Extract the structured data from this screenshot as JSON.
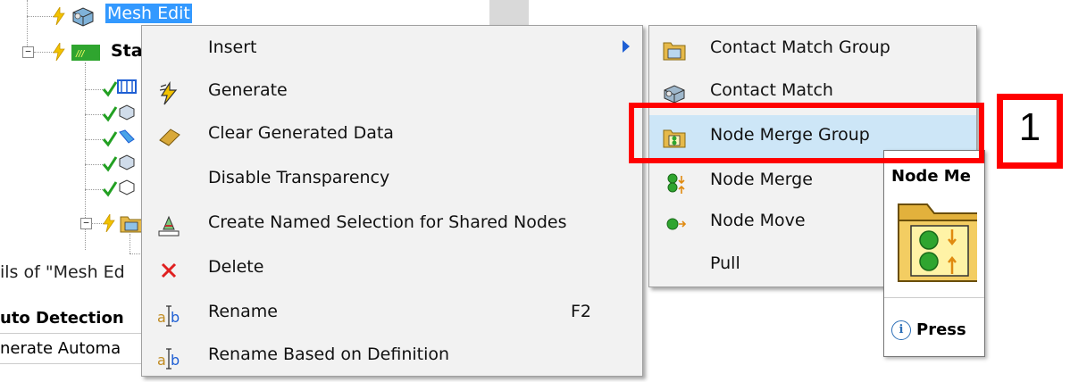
{
  "tree": {
    "mesh_edit_label": "Mesh Edit",
    "static_label": "Stat"
  },
  "details": {
    "title": "ils of \"Mesh Ed",
    "row1": "uto Detection",
    "row2": "nerate Automa"
  },
  "context_menu": {
    "items": [
      {
        "label": "Insert",
        "icon": "none",
        "has_submenu": true
      },
      {
        "label": "Generate",
        "icon": "lightning-icon"
      },
      {
        "label": "Clear Generated Data",
        "icon": "eraser-icon"
      },
      {
        "label": "Disable Transparency",
        "icon": "none"
      },
      {
        "label": "Create Named Selection for Shared Nodes",
        "icon": "named-selection-icon"
      },
      {
        "label": "Delete",
        "icon": "delete-x-icon"
      },
      {
        "label": "Rename",
        "icon": "rename-icon",
        "shortcut": "F2"
      },
      {
        "label": "Rename Based on Definition",
        "icon": "rename-icon"
      }
    ]
  },
  "submenu": {
    "items": [
      {
        "label": "Contact Match Group",
        "icon": "folder-group-icon"
      },
      {
        "label": "Contact Match",
        "icon": "contact-match-icon"
      },
      {
        "label": "Node Merge Group",
        "icon": "folder-node-merge-icon",
        "highlighted": true
      },
      {
        "label": "Node Merge",
        "icon": "node-merge-icon"
      },
      {
        "label": "Node Move",
        "icon": "node-move-icon"
      },
      {
        "label": "Pull",
        "icon": "none"
      }
    ]
  },
  "tooltip": {
    "title": "Node Me",
    "info_text": "Press"
  },
  "annotation": {
    "number": "1",
    "color": "#ff0000"
  }
}
